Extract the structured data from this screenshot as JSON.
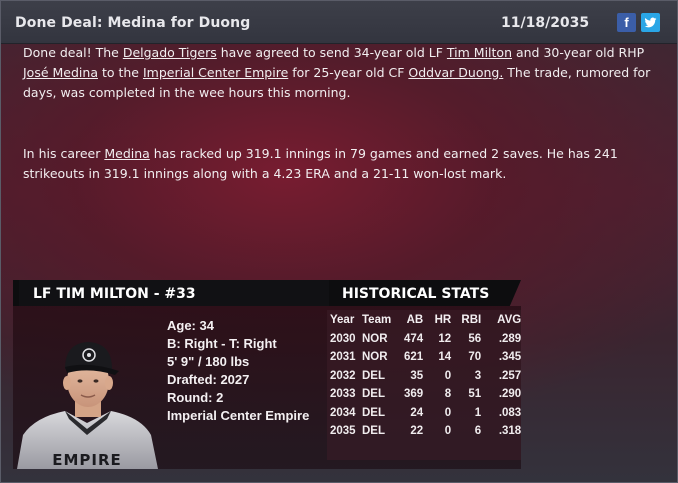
{
  "header": {
    "title": "Done Deal: Medina for Duong",
    "date": "11/18/2035",
    "facebook_glyph": "f",
    "icons": [
      "facebook-icon",
      "twitter-icon"
    ]
  },
  "article": {
    "p1": {
      "t1": "Done deal! The ",
      "team1": "Delgado Tigers",
      "t2": " have agreed to send 34-year old LF ",
      "player1": "Tim Milton",
      "t3": " and 30-year old RHP ",
      "player2": "José Medina",
      "t4": " to the ",
      "team2": "Imperial Center Empire",
      "t5": " for 25-year old CF ",
      "player3": "Oddvar Duong.",
      "t6": " The trade, rumored for days, was completed in the wee hours this morning."
    },
    "p2": {
      "t1": "In his career ",
      "player": "Medina",
      "t2": " has racked up 319.1 innings in 79 games and earned 2 saves. He has 241 strikeouts in 319.1 innings along with a 4.23 ERA and a 21-11 won-lost mark."
    }
  },
  "player_card": {
    "title": "LF TIM MILTON - #33",
    "stats_title": "HISTORICAL STATS",
    "photo_jersey_text": "EMPIRE",
    "info": {
      "age": "Age: 34",
      "bats_throws": "B: Right - T: Right",
      "height_weight": "5' 9\" / 180 lbs",
      "drafted": "Drafted: 2027",
      "round": "Round: 2",
      "team": "Imperial Center Empire"
    },
    "stats": {
      "columns": [
        "Year",
        "Team",
        "AB",
        "HR",
        "RBI",
        "AVG"
      ],
      "rows": [
        [
          "2030",
          "NOR",
          "474",
          "12",
          "56",
          ".289"
        ],
        [
          "2031",
          "NOR",
          "621",
          "14",
          "70",
          ".345"
        ],
        [
          "2032",
          "DEL",
          "35",
          "0",
          "3",
          ".257"
        ],
        [
          "2033",
          "DEL",
          "369",
          "8",
          "51",
          ".290"
        ],
        [
          "2034",
          "DEL",
          "24",
          "0",
          "1",
          ".083"
        ],
        [
          "2035",
          "DEL",
          "22",
          "0",
          "6",
          ".318"
        ]
      ]
    }
  }
}
